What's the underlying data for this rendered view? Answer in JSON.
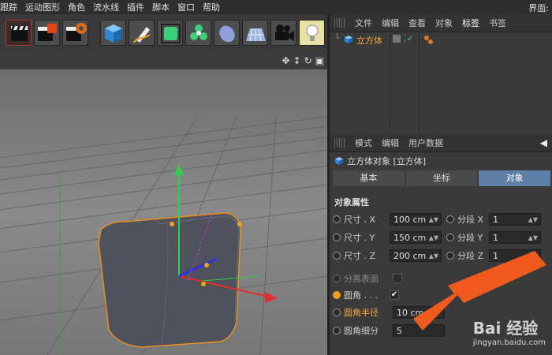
{
  "menu": {
    "items": [
      "跟踪",
      "运动图形",
      "角色",
      "流水线",
      "插件",
      "脚本",
      "窗口",
      "帮助"
    ],
    "right": "界面:"
  },
  "objects_panel": {
    "tabs": [
      "文件",
      "编辑",
      "查看",
      "对象",
      "标签",
      "书签"
    ],
    "object_name": "立方体"
  },
  "attributes_panel": {
    "tabs": [
      "模式",
      "编辑",
      "用户数据"
    ],
    "title": "立方体对象 [立方体]",
    "segment_tabs": [
      "基本",
      "坐标",
      "对象"
    ],
    "section": "对象属性",
    "size_rows": [
      {
        "label": "尺寸 . X",
        "value": "100 cm",
        "seg_label": "分段 X",
        "seg_value": "1"
      },
      {
        "label": "尺寸 . Y",
        "value": "150 cm",
        "seg_label": "分段 Y",
        "seg_value": "1"
      },
      {
        "label": "尺寸 . Z",
        "value": "200 cm",
        "seg_label": "分段 Z",
        "seg_value": "1"
      }
    ],
    "separate_surfaces": "分离表面",
    "fillet": "圆角 . . .",
    "fillet_radius_label": "圆角半径",
    "fillet_radius_value": "10 cm",
    "fillet_subdiv_label": "圆角细分",
    "fillet_subdiv_value": "5"
  },
  "watermark": {
    "text": "Bai 经验",
    "url": "jingyan.baidu.com"
  },
  "colors": {
    "accent": "#f0a020",
    "active_tab": "#5e7fa8",
    "arrow": "#f05a1e"
  }
}
